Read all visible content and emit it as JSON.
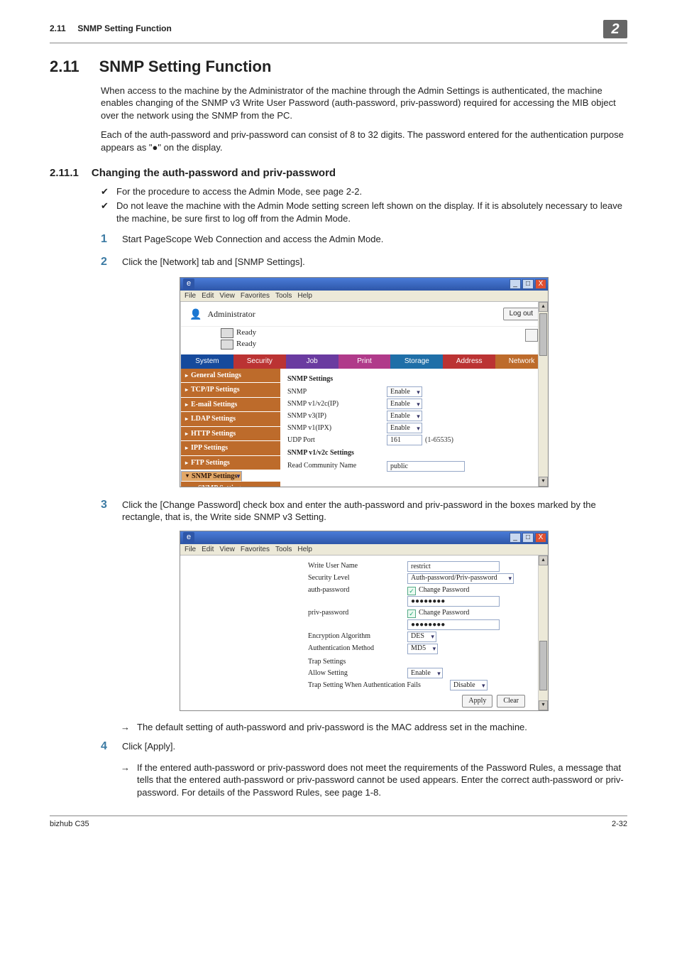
{
  "header": {
    "crumb_num": "2.11",
    "crumb_title": "SNMP Setting Function",
    "badge": "2"
  },
  "title": {
    "num": "2.11",
    "text": "SNMP Setting Function"
  },
  "intro": {
    "p1": "When access to the machine by the Administrator of the machine through the Admin Settings is authenticated, the machine enables changing of the SNMP v3 Write User Password (auth-password, priv-password) required for accessing the MIB object over the network using the SNMP from the PC.",
    "p2": "Each of the auth-password and priv-password can consist of 8 to 32 digits. The password entered for the authentication purpose appears as \"●\" on the display."
  },
  "sub": {
    "num": "2.11.1",
    "text": "Changing the auth-password and priv-password"
  },
  "checks": {
    "c1": "For the procedure to access the Admin Mode, see page 2-2.",
    "c2": "Do not leave the machine with the Admin Mode setting screen left shown on the display. If it is absolutely necessary to leave the machine, be sure first to log off from the Admin Mode."
  },
  "steps": {
    "s1": "Start PageScope Web Connection and access the Admin Mode.",
    "s2": "Click the [Network] tab and [SNMP Settings].",
    "s3": "Click the [Change Password] check box and enter the auth-password and priv-password in the boxes marked by the rectangle, that is, the Write side SNMP v3 Setting.",
    "s3_arrow": "The default setting of auth-password and priv-password is the MAC address set in the machine.",
    "s4": "Click [Apply].",
    "s4_arrow": "If the entered auth-password or priv-password does not meet the requirements of the Password Rules, a message that tells that the entered auth-password or priv-password cannot be used appears. Enter the correct auth-password or priv-password. For details of the Password Rules, see page 1-8."
  },
  "win_menu": {
    "file": "File",
    "edit": "Edit",
    "view": "View",
    "fav": "Favorites",
    "tools": "Tools",
    "help": "Help"
  },
  "win_btns": {
    "min": "_",
    "max": "□",
    "close": "X"
  },
  "shot1": {
    "admin_label": "Administrator",
    "logout": "Log out",
    "ready": "Ready",
    "tabs": {
      "system": "System",
      "security": "Security",
      "job": "Job",
      "print": "Print",
      "storage": "Storage",
      "address": "Address",
      "network": "Network"
    },
    "side": {
      "general": "General Settings",
      "tcpip": "TCP/IP Settings",
      "email": "E-mail Settings",
      "ldap": "LDAP Settings",
      "http": "HTTP Settings",
      "ipp": "IPP Settings",
      "ftp": "FTP Settings",
      "snmp": "SNMP Settings",
      "snmp2": "SNMP Settings"
    },
    "panel_title": "SNMP Settings",
    "rows": {
      "snmp": "SNMP",
      "v1v2cip": "SNMP v1/v2c(IP)",
      "v3ip": "SNMP v3(IP)",
      "v1ipx": "SNMP v1(IPX)",
      "udp": "UDP Port",
      "v1v2c_set": "SNMP v1/v2c Settings",
      "rcn": "Read Community Name"
    },
    "vals": {
      "enable": "Enable",
      "udp_port": "161",
      "udp_hint": "(1-65535)",
      "rcn_val": "public"
    }
  },
  "shot2": {
    "rows": {
      "wun": "Write User Name",
      "seclvl": "Security Level",
      "authpw": "auth-password",
      "privpw": "priv-password",
      "encalg": "Encryption Algorithm",
      "authmeth": "Authentication Method",
      "trap": "Trap Settings",
      "allow": "Allow Setting",
      "trap_auth": "Trap Setting When Authentication Fails"
    },
    "vals": {
      "wun": "restrict",
      "seclvl": "Auth-password/Priv-password",
      "chpw": "Change Password",
      "mask": "●●●●●●●●",
      "des": "DES",
      "md5": "MD5",
      "enable": "Enable",
      "disable": "Disable"
    },
    "btns": {
      "apply": "Apply",
      "clear": "Clear"
    }
  },
  "footer": {
    "left": "bizhub C35",
    "right": "2-32"
  }
}
